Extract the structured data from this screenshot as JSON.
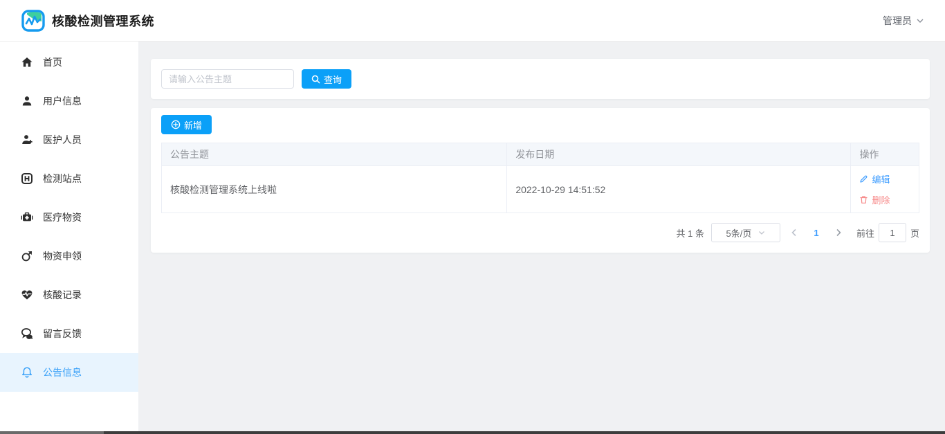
{
  "app": {
    "title": "核酸检测管理系统"
  },
  "header": {
    "user_label": "管理员"
  },
  "sidebar": {
    "active_index": 8,
    "items": [
      {
        "label": "首页",
        "icon": "home-icon"
      },
      {
        "label": "用户信息",
        "icon": "user-icon"
      },
      {
        "label": "医护人员",
        "icon": "medical-staff-icon"
      },
      {
        "label": "检测站点",
        "icon": "hospital-icon"
      },
      {
        "label": "医疗物资",
        "icon": "first-aid-kit-icon"
      },
      {
        "label": "物资申领",
        "icon": "apply-arrow-icon"
      },
      {
        "label": "核酸记录",
        "icon": "heartbeat-icon"
      },
      {
        "label": "留言反馈",
        "icon": "chat-bubbles-icon"
      },
      {
        "label": "公告信息",
        "icon": "bell-icon"
      }
    ]
  },
  "search": {
    "placeholder": "请输入公告主题",
    "query_label": "查询"
  },
  "toolbar": {
    "add_label": "新增"
  },
  "table": {
    "columns": [
      "公告主题",
      "发布日期",
      "操作"
    ],
    "rows": [
      {
        "subject": "核酸检测管理系统上线啦",
        "date": "2022-10-29 14:51:52"
      }
    ],
    "edit_label": "编辑",
    "delete_label": "删除"
  },
  "pagination": {
    "total_text": "共 1 条",
    "page_size": "5条/页",
    "current_page": "1",
    "goto_label": "前往",
    "goto_value": "1",
    "page_unit": "页"
  },
  "colors": {
    "primary": "#0ba0f8",
    "sidebar_active_text": "#3aa1f8",
    "sidebar_active_bg": "#e8f4fe",
    "edit_link": "#409eff",
    "delete_link": "#f78989",
    "table_header_bg": "#f4f7fb",
    "table_header_text": "#909399",
    "body_text": "#606266",
    "page_bg": "#f0f1f3"
  }
}
